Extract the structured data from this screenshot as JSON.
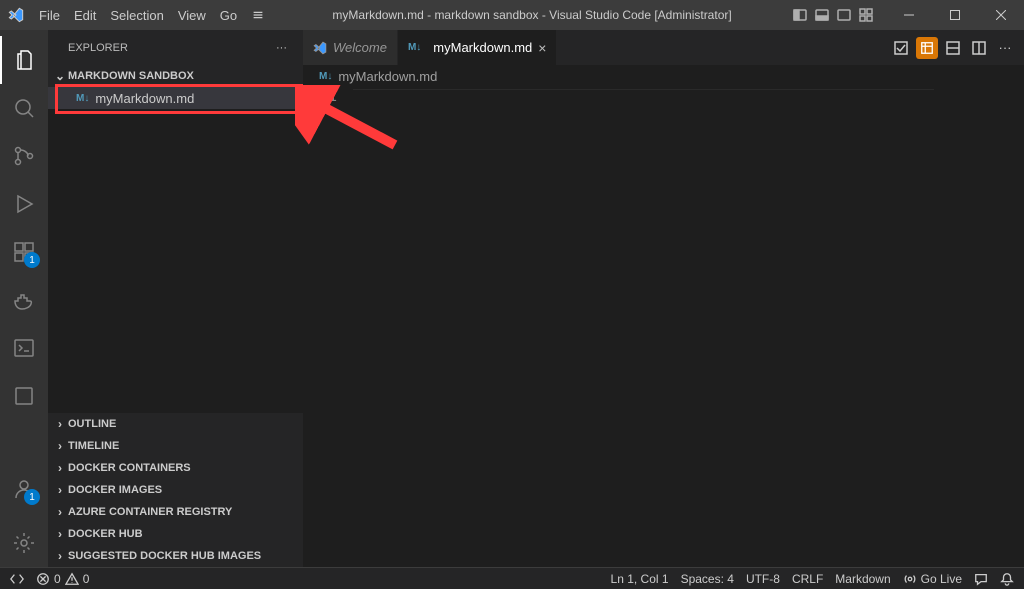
{
  "title": "myMarkdown.md - markdown sandbox - Visual Studio Code [Administrator]",
  "menu": [
    "File",
    "Edit",
    "Selection",
    "View",
    "Go"
  ],
  "sidebar": {
    "title": "EXPLORER",
    "workspace": "MARKDOWN SANDBOX",
    "files": [
      "myMarkdown.md"
    ],
    "panels": [
      "OUTLINE",
      "TIMELINE",
      "DOCKER CONTAINERS",
      "DOCKER IMAGES",
      "AZURE CONTAINER REGISTRY",
      "DOCKER HUB",
      "SUGGESTED DOCKER HUB IMAGES"
    ]
  },
  "tabs": [
    {
      "label": "Welcome",
      "icon": "vscode",
      "active": false
    },
    {
      "label": "myMarkdown.md",
      "icon": "md",
      "active": true
    }
  ],
  "breadcrumb": "myMarkdown.md",
  "editor": {
    "line_number": "1"
  },
  "activity_badges": {
    "extensions": "1",
    "accounts": "1"
  },
  "status": {
    "errors": "0",
    "warnings": "0",
    "ln_col": "Ln 1, Col 1",
    "spaces": "Spaces: 4",
    "encoding": "UTF-8",
    "eol": "CRLF",
    "language": "Markdown",
    "golive": "Go Live"
  }
}
